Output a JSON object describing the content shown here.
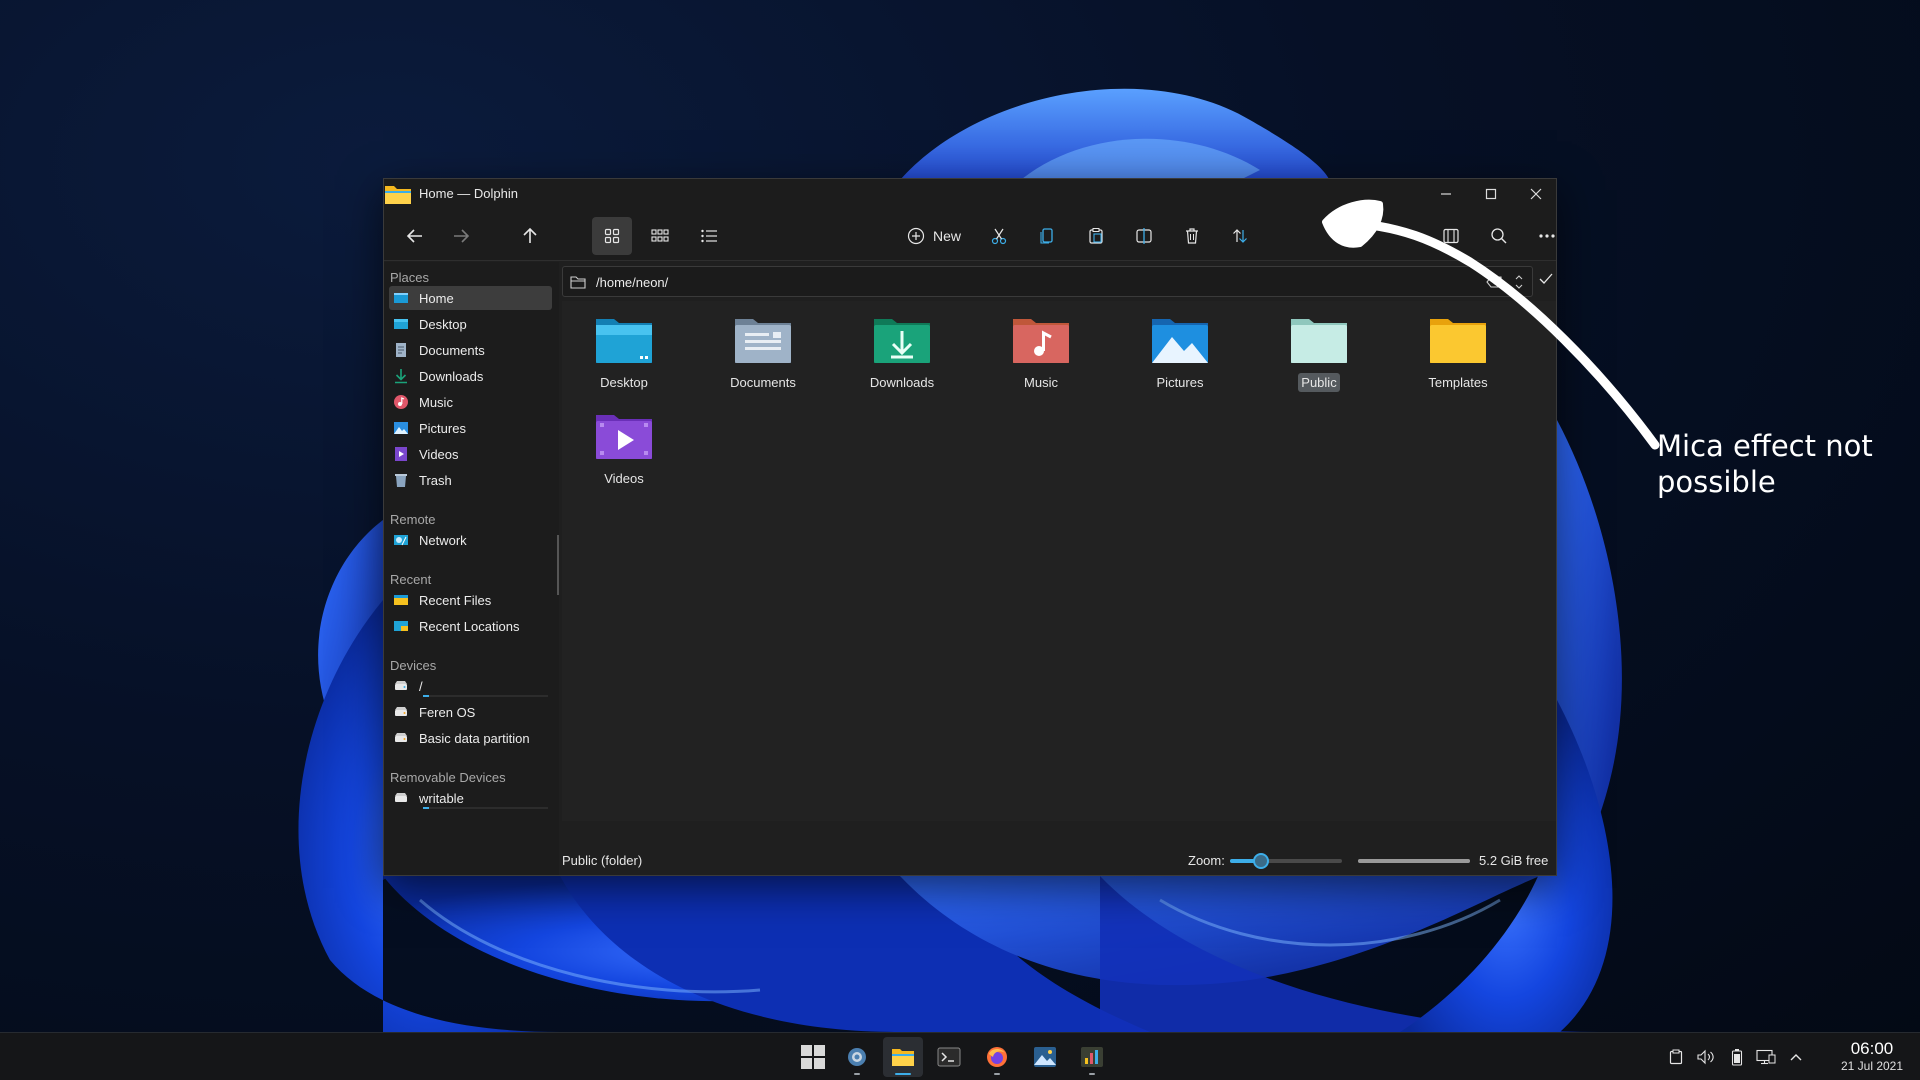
{
  "window": {
    "title": "Home — Dolphin"
  },
  "toolbar": {
    "new_label": "New",
    "icons": [
      "back-icon",
      "forward-icon",
      "up-icon",
      "icons-view-icon",
      "compact-view-icon",
      "details-view-icon",
      "new-icon",
      "cut-icon",
      "copy-icon",
      "paste-icon",
      "rename-icon",
      "trash-icon",
      "sort-icon",
      "split-icon",
      "search-icon",
      "menu-icon"
    ]
  },
  "sidebar": {
    "places_title": "Places",
    "places": [
      {
        "label": "Home",
        "icon": "home-icon"
      },
      {
        "label": "Desktop",
        "icon": "desktop-icon"
      },
      {
        "label": "Documents",
        "icon": "documents-icon"
      },
      {
        "label": "Downloads",
        "icon": "downloads-icon"
      },
      {
        "label": "Music",
        "icon": "music-icon"
      },
      {
        "label": "Pictures",
        "icon": "pictures-icon"
      },
      {
        "label": "Videos",
        "icon": "videos-icon"
      },
      {
        "label": "Trash",
        "icon": "trash-icon"
      }
    ],
    "remote_title": "Remote",
    "remote": [
      {
        "label": "Network",
        "icon": "network-icon"
      }
    ],
    "recent_title": "Recent",
    "recent": [
      {
        "label": "Recent Files",
        "icon": "recent-files-icon"
      },
      {
        "label": "Recent Locations",
        "icon": "recent-locations-icon"
      }
    ],
    "devices_title": "Devices",
    "devices": [
      {
        "label": "/",
        "icon": "drive-icon",
        "used": 0.05
      },
      {
        "label": "Feren OS",
        "icon": "drive-icon"
      },
      {
        "label": "Basic data partition",
        "icon": "drive-icon"
      }
    ],
    "removable_title": "Removable Devices",
    "removable": [
      {
        "label": "writable",
        "icon": "drive-removable-icon",
        "used": 0.05
      }
    ]
  },
  "location": {
    "path": "/home/neon/"
  },
  "files": [
    {
      "label": "Desktop",
      "icon": "folder-desktop-icon",
      "color": "#1fa3d6"
    },
    {
      "label": "Documents",
      "icon": "folder-documents-icon",
      "color": "#8fa3b8"
    },
    {
      "label": "Downloads",
      "icon": "folder-downloads-icon",
      "color": "#1aa37a"
    },
    {
      "label": "Music",
      "icon": "folder-music-icon",
      "color": "#e0784a"
    },
    {
      "label": "Pictures",
      "icon": "folder-pictures-icon",
      "color": "#1e8fe0"
    },
    {
      "label": "Public",
      "icon": "folder-public-icon",
      "color": "#b9e3dc"
    },
    {
      "label": "Templates",
      "icon": "folder-templates-icon",
      "color": "#f5c11f"
    },
    {
      "label": "Videos",
      "icon": "folder-videos-icon",
      "color": "#8a4bd8"
    }
  ],
  "selected_file": "Public",
  "status": {
    "text": "Public (folder)",
    "zoom_label": "Zoom:",
    "zoom_level": 0.28,
    "free_label": "5.2 GiB free",
    "disk_used": 1.0
  },
  "annotation": {
    "text": "Mica effect not possible"
  },
  "taskbar": {
    "apps": [
      "start-icon",
      "settings-icon",
      "file-manager-icon",
      "terminal-icon",
      "firefox-icon",
      "image-viewer-icon",
      "system-monitor-icon"
    ],
    "active_app": "file-manager-icon",
    "tray": [
      "clipboard-icon",
      "volume-icon",
      "battery-icon",
      "display-icon",
      "chevron-up-icon"
    ],
    "time": "06:00",
    "date": "21 Jul 2021"
  },
  "colors": {
    "accent": "#3daee9",
    "window_bg": "#1f1f1f",
    "view_bg": "#222222"
  }
}
